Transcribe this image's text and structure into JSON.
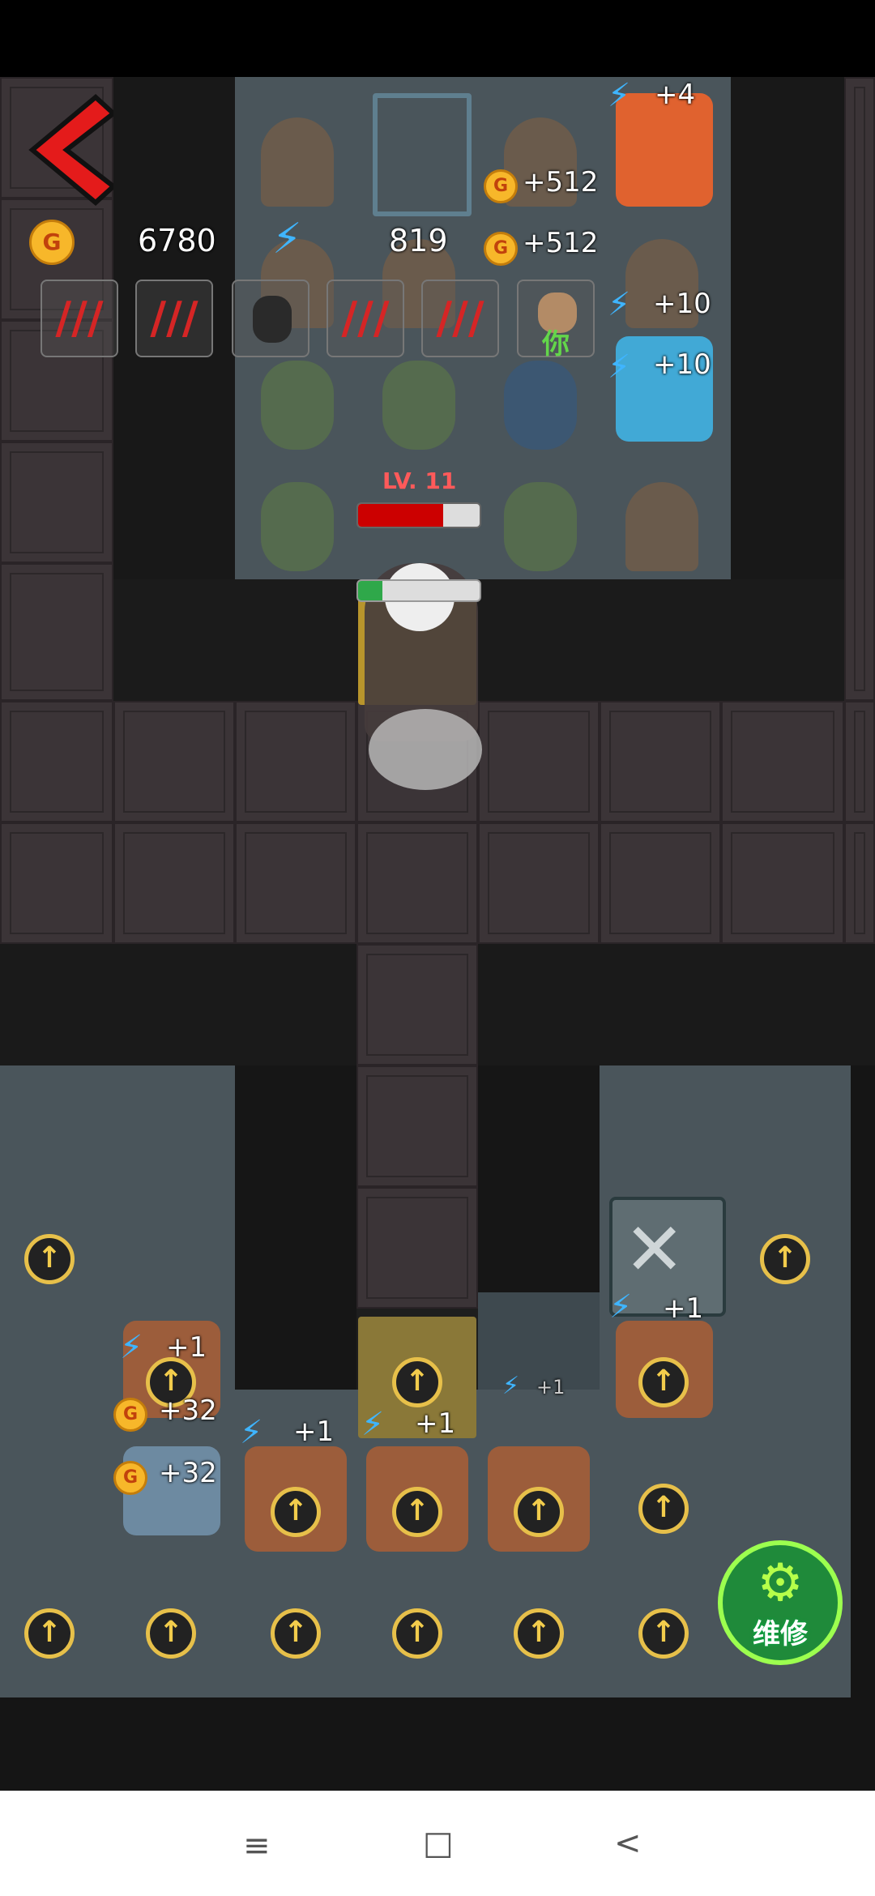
{
  "hud": {
    "gold": "6780",
    "energy": "819",
    "gold_coin_label": "G"
  },
  "enemy": {
    "level": "LV. 11",
    "health_fraction": 0.7,
    "shield_fraction": 0.2
  },
  "floating_texts": {
    "t1": "+4",
    "t2": "+512",
    "t3": "+512",
    "t4": "+10",
    "t5": "+10",
    "t6": "+1",
    "t7": "+32",
    "t8": "+32",
    "t9": "+1",
    "t10": "+1",
    "t11": "+1",
    "t12": "+1"
  },
  "player_tag": "你",
  "repair_button": {
    "label": "维修"
  },
  "colors": {
    "accent": "#e7c04a",
    "danger": "#c00000",
    "energy": "#3fb5ff",
    "repair": "#1f8a3a"
  },
  "icons": {
    "back": "chevron-left-icon",
    "upgrade": "arrow-up-circle-icon",
    "energy": "lightning-icon",
    "gold": "gold-coin-icon",
    "repair": "gear-wrench-icon"
  },
  "nav": {
    "menu": "≡",
    "home": "□",
    "back": "<"
  }
}
